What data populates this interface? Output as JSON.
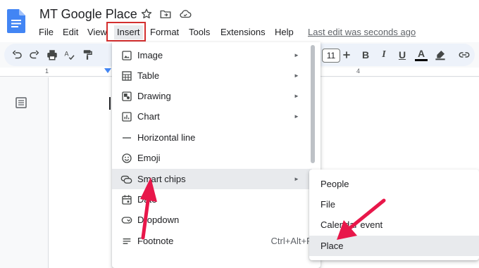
{
  "document": {
    "title": "MT Google Place",
    "last_edit": "Last edit was seconds ago"
  },
  "menubar": {
    "items": [
      "File",
      "Edit",
      "View",
      "Insert",
      "Format",
      "Tools",
      "Extensions",
      "Help"
    ]
  },
  "toolbar": {
    "font_size": "11",
    "bold": "B",
    "italic": "I",
    "underline": "U",
    "text_color": "A",
    "text_color_value": "#000000"
  },
  "ruler": {
    "left_number": "1",
    "right_number": "4"
  },
  "insert_menu": {
    "items": [
      {
        "label": "Image",
        "icon": "image-icon",
        "submenu": true
      },
      {
        "label": "Table",
        "icon": "table-icon",
        "submenu": true
      },
      {
        "label": "Drawing",
        "icon": "drawing-icon",
        "submenu": true
      },
      {
        "label": "Chart",
        "icon": "chart-icon",
        "submenu": true
      },
      {
        "label": "Horizontal line",
        "icon": "horizontal-line-icon",
        "submenu": false
      },
      {
        "label": "Emoji",
        "icon": "emoji-icon",
        "submenu": false
      },
      {
        "label": "Smart chips",
        "icon": "smart-chips-icon",
        "submenu": true,
        "active": true
      },
      {
        "label": "Date",
        "icon": "calendar-icon",
        "submenu": false
      },
      {
        "label": "Dropdown",
        "icon": "dropdown-icon",
        "submenu": false
      },
      {
        "label": "Footnote",
        "icon": "footnote-icon",
        "submenu": false,
        "shortcut": "Ctrl+Alt+F"
      }
    ]
  },
  "smart_chips_submenu": {
    "items": [
      {
        "label": "People"
      },
      {
        "label": "File"
      },
      {
        "label": "Calendar event"
      },
      {
        "label": "Place",
        "active": true
      }
    ]
  },
  "colors": {
    "highlight_box": "#d32f2f",
    "arrow": "#e8174a",
    "menu_active": "#e8eaed",
    "docs_blue": "#4285f4",
    "toolbar_bg": "#edf2fa"
  }
}
